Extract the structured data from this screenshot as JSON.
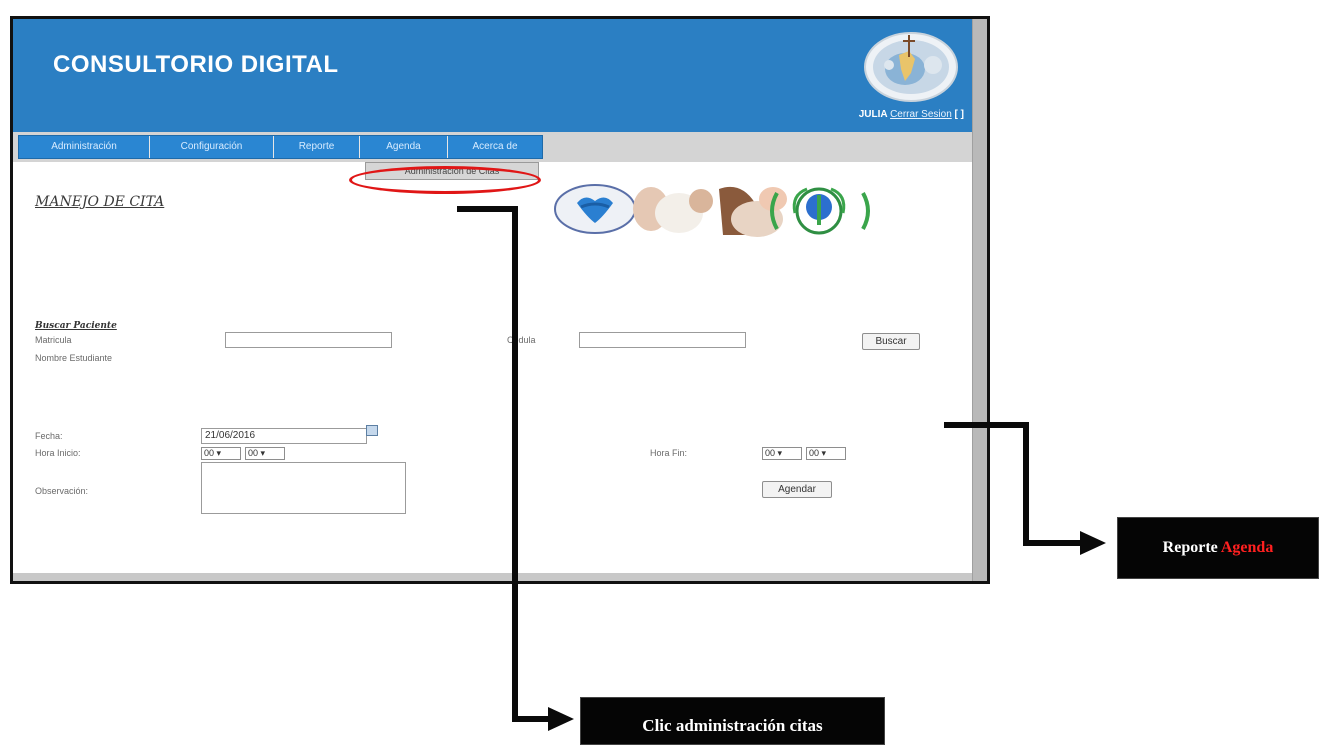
{
  "app": {
    "title": "CONSULTORIO DIGITAL"
  },
  "user": {
    "name": "JULIA",
    "logout_label": "Cerrar Sesion",
    "brackets": "[ ]"
  },
  "nav": {
    "items": [
      {
        "label": "Administración"
      },
      {
        "label": "Configuración"
      },
      {
        "label": "Reporte"
      },
      {
        "label": "Agenda"
      },
      {
        "label": "Acerca de"
      }
    ],
    "dropdown_item": "Administración de Citas"
  },
  "page": {
    "heading": "MANEJO DE CITA"
  },
  "search": {
    "section_title": "Buscar Paciente",
    "matricula_label": "Matricula",
    "nombre_label": "Nombre Estudiante",
    "cedula_label": "Cédula",
    "matricula_value": "",
    "cedula_value": "",
    "button_label": "Buscar"
  },
  "appointment": {
    "fecha_label": "Fecha:",
    "fecha_value": "21/06/2016",
    "hora_inicio_label": "Hora Inicio:",
    "hora_fin_label": "Hora Fin:",
    "hora_inicio_h": "00 ▾",
    "hora_inicio_m": "00 ▾",
    "hora_fin_h": "00 ▾",
    "hora_fin_m": "00 ▾",
    "observacion_label": "Observación:",
    "agendar_label": "Agendar"
  },
  "callouts": {
    "reporte_word1": "Reporte",
    "reporte_word2": "Agenda",
    "clic": "Clic administración citas"
  },
  "colors": {
    "header_blue": "#2b7fc3",
    "highlight_red": "#e01616",
    "callout_bg": "#050505"
  }
}
